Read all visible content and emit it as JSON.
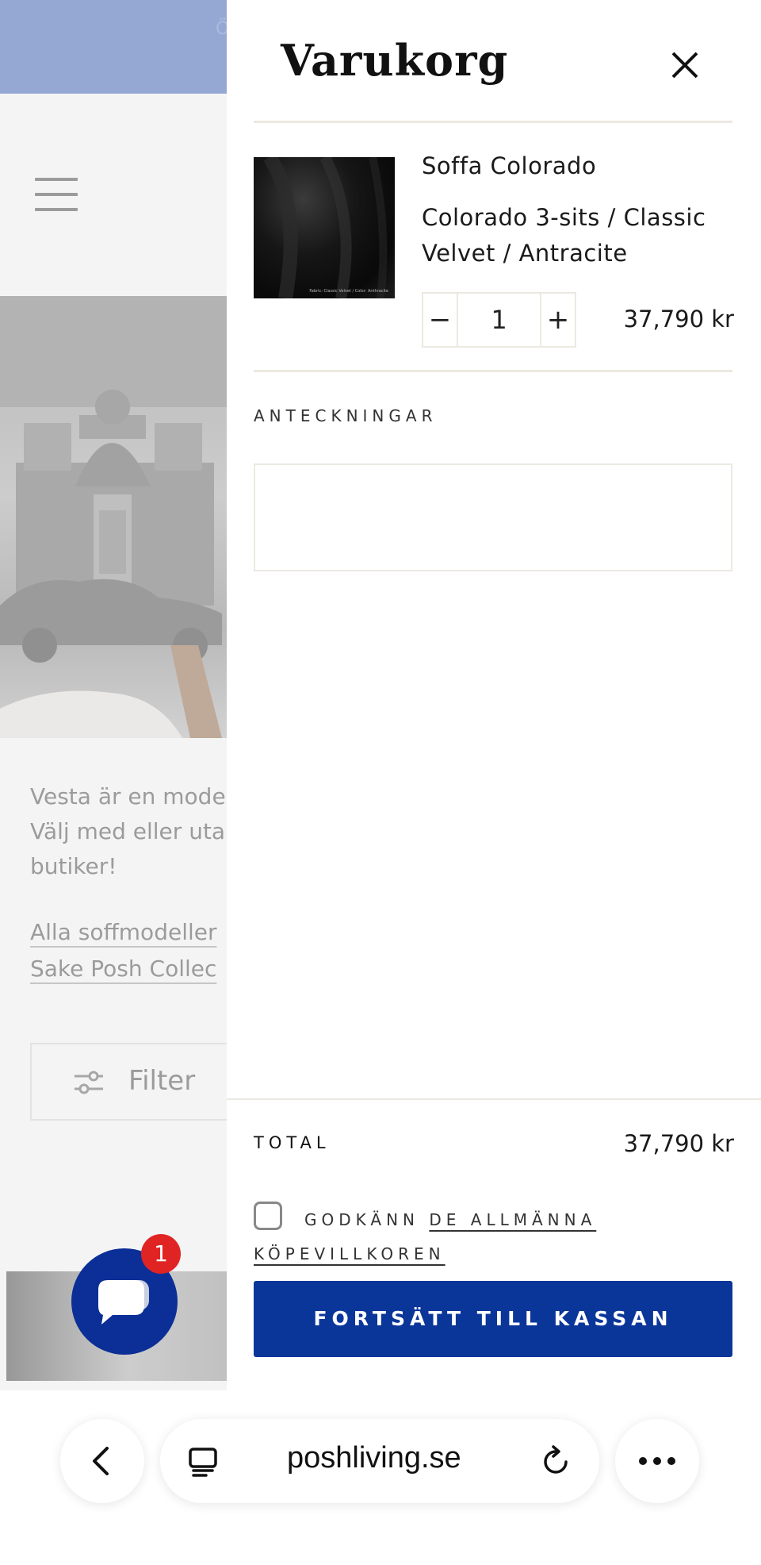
{
  "background_page": {
    "announcement_text": "Ö",
    "description": "Vesta är en mode\nVälj med eller uta\nbutiker!",
    "links": [
      "Alla soffmodeller",
      "Sake Posh Collec"
    ],
    "filter_label": "Filter"
  },
  "chat": {
    "badge_count": "1",
    "icon": "chat-bubble-icon"
  },
  "cart": {
    "title": "Varukorg",
    "item": {
      "name": "Soffa Colorado",
      "variant": "Colorado 3-sits / Classic Velvet / Antracite",
      "image_caption": "Fabric: Classic Velvet / Color: Anthracite",
      "quantity": "1",
      "minus_label": "−",
      "plus_label": "+",
      "price": "37,790 kr"
    },
    "notes_label": "ANTECKNINGAR",
    "total_label": "TOTAL",
    "total_value": "37,790 kr",
    "terms_prefix": "GODKÄNN",
    "terms_link": "DE ALLMÄNNA KÖPEVILLKOREN",
    "checkout_label": "FORTSÄTT TILL KASSAN"
  },
  "browser": {
    "url": "poshliving.se"
  },
  "colors": {
    "accent": "#0b3699",
    "badge": "#e02424",
    "announcement": "#1a4096"
  }
}
